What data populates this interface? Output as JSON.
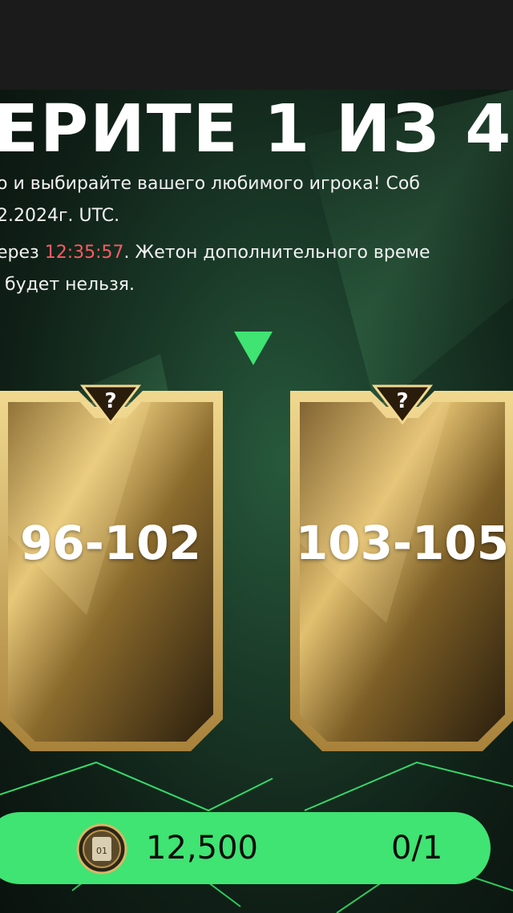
{
  "title": "ЕРИТЕ 1 ИЗ 4",
  "description": {
    "line1": "о и выбирайте вашего любимого игрока! Соб",
    "line2": "2.2024г. UTC.",
    "line3_prefix": "ерез ",
    "line3_timer": "12:35:57",
    "line3_suffix": ". Жетон дополнительного време",
    "line4": "будет нельзя."
  },
  "cards": [
    {
      "range": "96-102",
      "badge": "?"
    },
    {
      "range": "103-105",
      "badge": "?"
    }
  ],
  "bottom_bar": {
    "coin_label": "01",
    "price": "12,500",
    "count": "0/1"
  },
  "colors": {
    "accent_green": "#3fe472",
    "timer_red": "#ff5a63",
    "gold": "#c9a24a"
  }
}
